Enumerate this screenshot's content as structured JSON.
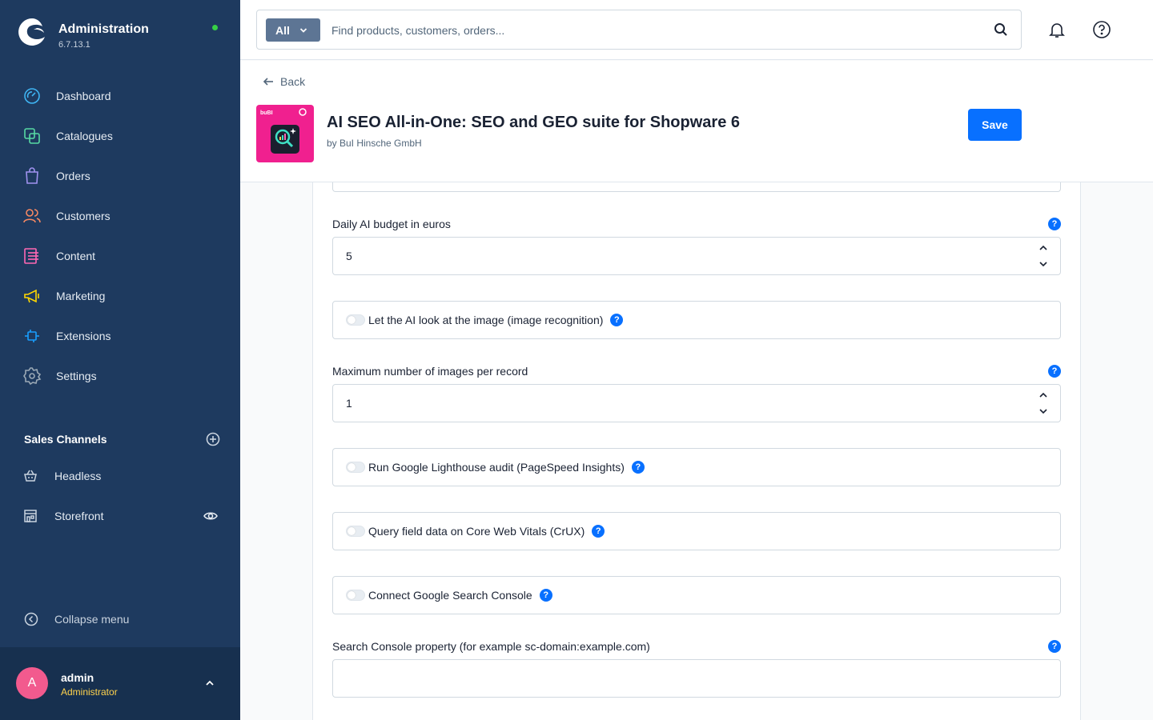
{
  "app": {
    "title": "Administration",
    "version": "6.7.13.1"
  },
  "nav": {
    "items": [
      {
        "label": "Dashboard",
        "icon": "dashboard-icon",
        "color": "#3fb4f2"
      },
      {
        "label": "Catalogues",
        "icon": "catalogues-icon",
        "color": "#57d9a3"
      },
      {
        "label": "Orders",
        "icon": "orders-icon",
        "color": "#a092f0"
      },
      {
        "label": "Customers",
        "icon": "customers-icon",
        "color": "#f88962"
      },
      {
        "label": "Content",
        "icon": "content-icon",
        "color": "#ff68b4"
      },
      {
        "label": "Marketing",
        "icon": "marketing-icon",
        "color": "#ffd700"
      },
      {
        "label": "Extensions",
        "icon": "extensions-icon",
        "color": "#189eff"
      },
      {
        "label": "Settings",
        "icon": "settings-icon",
        "color": "#9aa8b5"
      }
    ]
  },
  "sales_channels": {
    "title": "Sales Channels",
    "items": [
      {
        "label": "Headless",
        "icon": "basket-icon"
      },
      {
        "label": "Storefront",
        "icon": "storefront-icon"
      }
    ]
  },
  "collapse_label": "Collapse menu",
  "user": {
    "initial": "A",
    "name": "admin",
    "role": "Administrator"
  },
  "search": {
    "type_label": "All",
    "placeholder": "Find products, customers, orders..."
  },
  "header": {
    "back_label": "Back",
    "title": "AI SEO All-in-One: SEO and GEO suite for Shopware 6",
    "vendor": "by BuI Hinsche GmbH",
    "save_label": "Save"
  },
  "form": {
    "daily_budget": {
      "label": "Daily AI budget in euros",
      "value": "5"
    },
    "image_recognition": {
      "label": "Let the AI look at the image (image recognition)",
      "enabled": false
    },
    "max_images": {
      "label": "Maximum number of images per record",
      "value": "1"
    },
    "lighthouse": {
      "label": "Run Google Lighthouse audit (PageSpeed Insights)",
      "enabled": false
    },
    "crux": {
      "label": "Query field data on Core Web Vitals (CrUX)",
      "enabled": false
    },
    "search_console": {
      "label": "Connect Google Search Console",
      "enabled": false
    },
    "sc_property": {
      "label": "Search Console property (for example sc-domain:example.com)",
      "value": ""
    }
  },
  "help_glyph": "?",
  "colors": {
    "sidebar": "#1e3a5f",
    "primary": "#0870ff",
    "status_online": "#37d046"
  }
}
